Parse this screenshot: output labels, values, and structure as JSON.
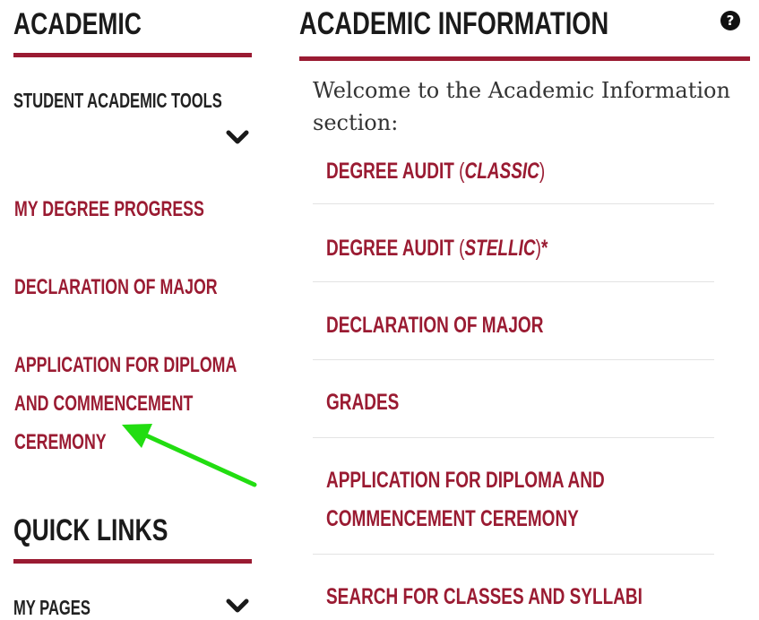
{
  "sidebar": {
    "heading": "ACADEMIC",
    "tools_label": "STUDENT ACADEMIC TOOLS",
    "links": [
      {
        "lines": [
          "MY DEGREE PROGRESS"
        ]
      },
      {
        "lines": [
          "DECLARATION OF MAJOR"
        ]
      },
      {
        "lines": [
          "APPLICATION FOR DIPLOMA",
          "AND COMMENCEMENT",
          "CEREMONY"
        ]
      }
    ],
    "quick_links_heading": "QUICK LINKS",
    "my_pages_label": "MY PAGES"
  },
  "main": {
    "title": "ACADEMIC INFORMATION",
    "help_icon": "?",
    "welcome": "Welcome to the Academic Information section:",
    "links": [
      {
        "pre": "DEGREE AUDIT ",
        "open": "(",
        "ital": "CLASSIC",
        "close": ")",
        "suffix": ""
      },
      {
        "pre": "DEGREE AUDIT ",
        "open": "(",
        "ital": "STELLIC",
        "close": ")",
        "suffix": "*"
      },
      {
        "line1": "DECLARATION OF MAJOR"
      },
      {
        "line1": "GRADES"
      },
      {
        "line1": "APPLICATION FOR DIPLOMA AND",
        "line2": "COMMENCEMENT CEREMONY"
      },
      {
        "line1": "SEARCH FOR CLASSES AND SYLLABI"
      }
    ]
  },
  "annotation": {
    "arrow_color": "#22dd11"
  },
  "colors": {
    "accent": "#9a1b32",
    "heading": "#1a1a1a"
  }
}
